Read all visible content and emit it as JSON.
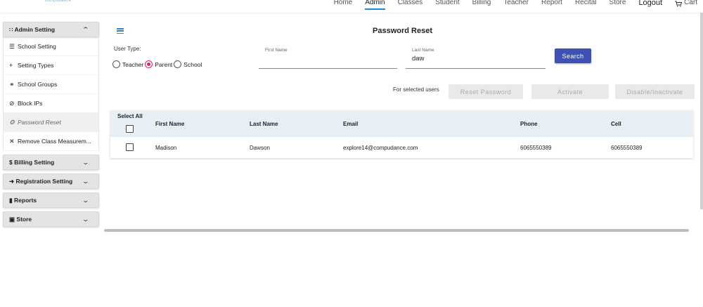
{
  "brand": {
    "logo_text": "compudance"
  },
  "nav": {
    "items": [
      "Home",
      "Admin",
      "Classes",
      "Student",
      "Billing",
      "Teacher",
      "Report",
      "Recital",
      "Store"
    ],
    "logout": "Logout",
    "cart": "Cart",
    "active": "Admin",
    "accent_color": "#1e88e5"
  },
  "sidebar": {
    "admin_setting": {
      "label": "Admin Setting",
      "items": [
        {
          "label": "School Setting",
          "icon": "list-icon"
        },
        {
          "label": "Setting Types",
          "icon": "plus-icon"
        },
        {
          "label": "School Groups",
          "icon": "link-icon"
        },
        {
          "label": "Block IPs",
          "icon": "block-icon"
        },
        {
          "label": "Password Reset",
          "icon": "gear-icon"
        },
        {
          "label": "Remove Class Measurem...",
          "icon": "close-icon"
        }
      ]
    },
    "billing_setting": {
      "label": "Billing Setting"
    },
    "registration_setting": {
      "label": "Registration Setting"
    },
    "reports": {
      "label": "Reports"
    },
    "store": {
      "label": "Store"
    }
  },
  "main": {
    "title": "Password Reset",
    "user_type_label": "User Type:",
    "user_types": [
      {
        "label": "Teacher",
        "checked": false
      },
      {
        "label": "Parent",
        "checked": true
      },
      {
        "label": "School",
        "checked": false
      }
    ],
    "first_name": {
      "label": "First Name",
      "value": ""
    },
    "last_name": {
      "label": "Last Name",
      "value": "daw"
    },
    "search_label": "Search",
    "for_selected_label": "For selected users",
    "actions": [
      "Reset Password",
      "Activate",
      "Disable/Inactivate"
    ],
    "primary_color": "#3f51b5",
    "radio_color": "#e91e63"
  },
  "table": {
    "select_all_label": "Select All",
    "headers": [
      "First Name",
      "Last Name",
      "Email",
      "Phone",
      "Cell"
    ],
    "rows": [
      {
        "first_name": "Madison",
        "last_name": "Dawson",
        "email": "explore14@compudance.com",
        "phone": "6065550389",
        "cell": "6065550389"
      }
    ],
    "header_bg": "#e7f0f6"
  }
}
